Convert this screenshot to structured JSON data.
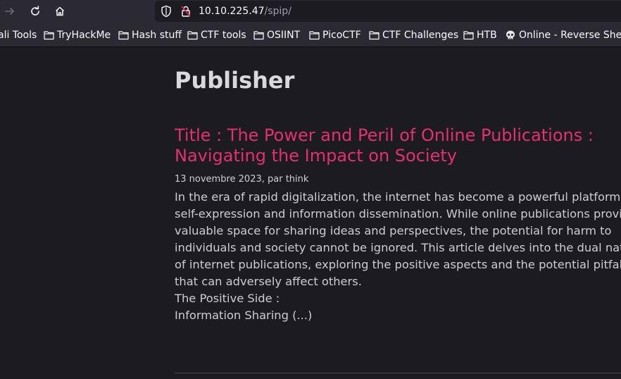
{
  "browser": {
    "url_host": "10.10.225.47",
    "url_path": "/spip/"
  },
  "bookmarks": [
    {
      "label": "ali Tools",
      "icon": "none"
    },
    {
      "label": "TryHackMe",
      "icon": "folder-icon"
    },
    {
      "label": "Hash stuff",
      "icon": "folder-icon"
    },
    {
      "label": "CTF tools",
      "icon": "folder-icon"
    },
    {
      "label": "OSIINT",
      "icon": "folder-icon"
    },
    {
      "label": "PicoCTF",
      "icon": "folder-icon"
    },
    {
      "label": "CTF Challenges",
      "icon": "folder-icon"
    },
    {
      "label": "HTB",
      "icon": "folder-icon"
    },
    {
      "label": "Online - Reverse Shell",
      "icon": "skull-icon"
    }
  ],
  "page": {
    "site_title": "Publisher",
    "article": {
      "title": "Title : The Power and Peril of Online Publications : Navigating the Impact on Society",
      "meta": "13 novembre 2023, par think",
      "body_lines": [
        "In the era of rapid digitalization, the internet has become a powerful platform for",
        "self-expression and information dissemination. While online publications provide a",
        "valuable space for sharing ideas and perspectives, the potential for harm to",
        "individuals and society cannot be ignored. This article delves into the dual nature",
        "of internet publications, exploring the positive aspects and the potential pitfalls",
        "that can adversely affect others."
      ],
      "subheading": "The Positive Side :",
      "last_line": "Information Sharing (...)"
    }
  },
  "colors": {
    "accent_link": "#e3316c",
    "page_background": "#1c1b22",
    "toolbar_background": "#2b2a33"
  }
}
